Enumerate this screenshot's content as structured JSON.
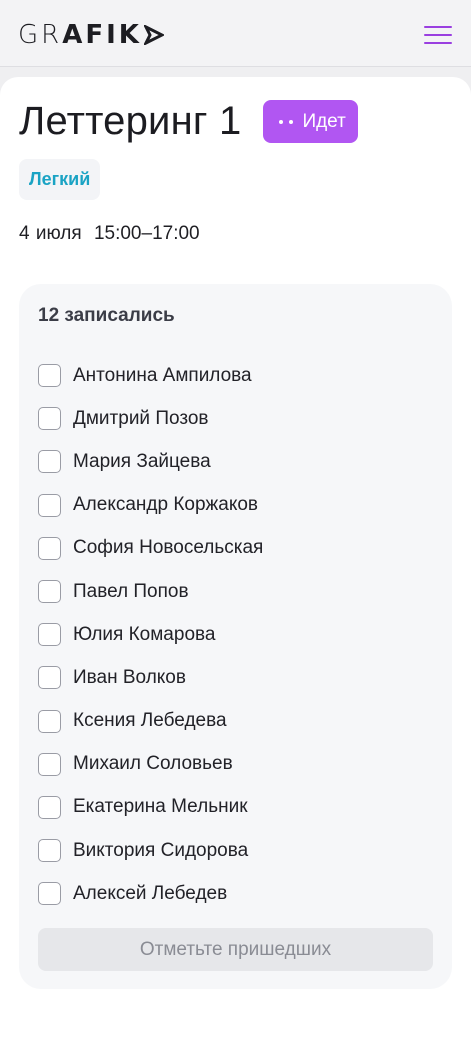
{
  "header": {
    "logo_text_thin": "GR",
    "logo_text_bold": "AFIK",
    "logo_arrow_icon": "play-arrow-icon",
    "menu_icon": "hamburger-menu-icon",
    "accent_color": "#9a3fe0"
  },
  "lesson": {
    "title": "Леттеринг 1",
    "status": "Идет",
    "status_color": "#b156f2",
    "level": "Легкий",
    "level_color": "#1aa3c4",
    "date": "4 июля",
    "time": "15:00–17:00"
  },
  "attendance": {
    "count_label": "12 записались",
    "participants": [
      {
        "name": "Антонина Ампилова",
        "checked": false
      },
      {
        "name": "Дмитрий Позов",
        "checked": false
      },
      {
        "name": "Мария Зайцева",
        "checked": false
      },
      {
        "name": "Александр Коржаков",
        "checked": false
      },
      {
        "name": "София Новосельская",
        "checked": false
      },
      {
        "name": "Павел Попов",
        "checked": false
      },
      {
        "name": "Юлия Комарова",
        "checked": false
      },
      {
        "name": "Иван Волков",
        "checked": false
      },
      {
        "name": "Ксения Лебедева",
        "checked": false
      },
      {
        "name": "Михаил Соловьев",
        "checked": false
      },
      {
        "name": "Екатерина Мельник",
        "checked": false
      },
      {
        "name": "Виктория Сидорова",
        "checked": false
      },
      {
        "name": "Алексей Лебедев",
        "checked": false
      }
    ],
    "submit_label": "Отметьте пришедших"
  }
}
